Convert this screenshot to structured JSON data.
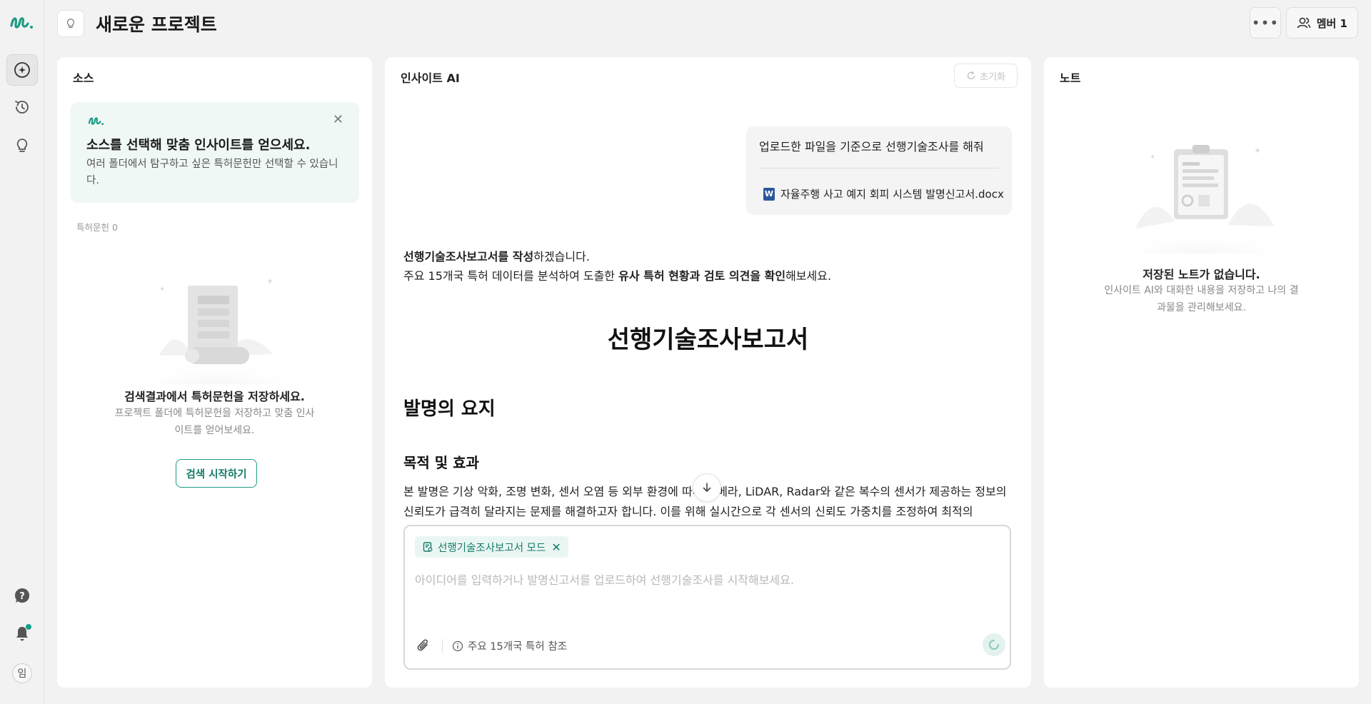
{
  "header": {
    "project_title": "새로운 프로젝트",
    "more_label": "•••",
    "member_label": "멤버 1"
  },
  "source": {
    "title": "소스",
    "tip": {
      "title": "소스를 선택해 맞춤 인사이트를 얻으세요.",
      "description": "여러 폴더에서 탐구하고 싶은 특허문헌만 선택할 수 있습니다.",
      "close": "✕"
    },
    "patent_count": "특허문헌 0",
    "empty_title": "검색결과에서 특허문헌을 저장하세요.",
    "empty_desc": "프로젝트 폴더에 특허문헌을 저장하고 맞춤 인사이트를 얻어보세요.",
    "start_button": "검색 시작하기"
  },
  "insight": {
    "title": "인사이트 AI",
    "reset_label": "초기화",
    "user_message": "업로드한 파일을 기준으로 선행기술조사를 해줘",
    "file_icon": "W",
    "file_name": "자율주행 사고 예지 회피 시스템 발명신고서.docx",
    "intro_bold_1": "선행기술조사보고서를 작성",
    "intro_text_1": "하겠습니다.",
    "intro_text_2a": "주요 15개국 특허 데이터를 분석하여 도출한 ",
    "intro_bold_2": "유사 특허 현황과 검토 의견을 확인",
    "intro_text_2b": "해보세요.",
    "report_title": "선행기술조사보고서",
    "section_heading": "발명의 요지",
    "subsection_heading": "목적 및 효과",
    "body": "본 발명은 기상 악화, 조명 변화, 센서 오염 등 외부 환경에 따라 카메라, LiDAR, Radar와 같은 복수의 센서가 제공하는 정보의 신뢰도가 급격히 달라지는 문제를 해결하고자 합니다. 이를 위해 실시간으로 각 센서의 신뢰도 가중치를 조정하여 최적의",
    "composer": {
      "mode_label": "선행기술조사보고서 모드",
      "mode_close": "✕",
      "placeholder": "아이디어를 입력하거나 발명신고서를 업로드하여 선행기술조사를 시작해보세요.",
      "reference": "주요 15개국 특허 참조"
    }
  },
  "notes": {
    "title": "노트",
    "empty_title": "저장된 노트가 없습니다.",
    "empty_desc": "인사이트 AI와 대화한 내용을 저장하고 나의 결과물을 관리해보세요."
  },
  "rail": {
    "avatar_initial": "임"
  },
  "colors": {
    "brand": "#1e9c84",
    "background": "#f2f2f2",
    "panel": "#ffffff"
  }
}
